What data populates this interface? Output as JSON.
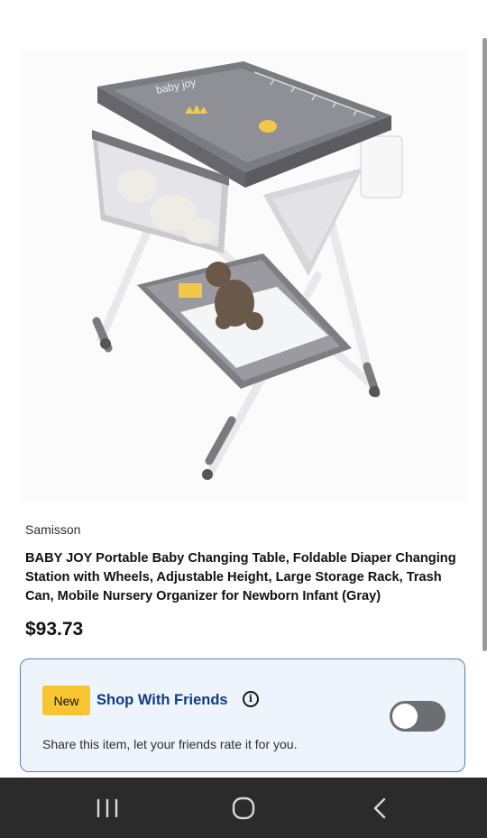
{
  "product": {
    "image_alt": "Portable baby changing table with storage basket, lower rack and trash can",
    "image_logo_text": "baby joy",
    "seller": "Samisson",
    "title": "BABY JOY Portable Baby Changing Table, Foldable Diaper Changing Station with Wheels, Adjustable Height, Large Storage Rack, Trash Can, Mobile Nursery Organizer for Newborn Infant (Gray)",
    "price": "$93.73"
  },
  "shop_with_friends": {
    "badge": "New",
    "title": "Shop With Friends",
    "info_icon": "i",
    "description": "Share this item, let your friends rate it for you.",
    "toggle_on": false
  },
  "navbar": {
    "icons": [
      "recents-icon",
      "home-icon",
      "back-icon"
    ]
  },
  "colors": {
    "accent": "#0d3b8a",
    "badge": "#f7c52f",
    "card_bg": "#eef4fb",
    "card_border": "#5a7db8",
    "navbar": "#2b2b2b"
  }
}
